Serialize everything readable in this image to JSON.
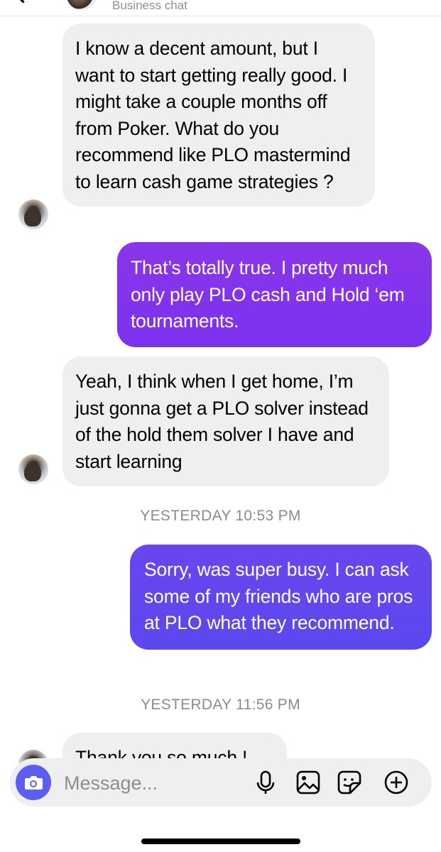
{
  "header": {
    "subtitle": "Business chat"
  },
  "messages": [
    {
      "direction": "incoming",
      "text": "I know a decent amount, but I want to start getting really good. I might take a couple months off from Poker. What do you recommend like PLO mastermind to learn cash game strategies ?"
    },
    {
      "direction": "outgoing",
      "text": "That’s totally true.  I pretty much only play PLO cash and Hold ‘em tournaments."
    },
    {
      "direction": "incoming",
      "text": "Yeah, I think when I get home, I’m just gonna get a PLO solver instead of the hold them solver I have and start learning"
    },
    {
      "direction": "outgoing",
      "text": "Sorry, was super busy.  I can ask some of my friends who are pros at PLO what they recommend."
    },
    {
      "direction": "incoming",
      "text": "Thank you so much !"
    }
  ],
  "timestamps": [
    "YESTERDAY 10:53 PM",
    "YESTERDAY 11:56 PM"
  ],
  "composer": {
    "placeholder": "Message..."
  },
  "colors": {
    "incoming_bubble": "#efeff2",
    "outgoing_bubble_purple": "#7b32ee",
    "outgoing_bubble_indigo": "#5a48ee",
    "camera_button": "#5b5ef0"
  },
  "icons": [
    "back-chevron-icon",
    "camera-icon",
    "microphone-icon",
    "gallery-icon",
    "sticker-icon",
    "plus-icon"
  ]
}
